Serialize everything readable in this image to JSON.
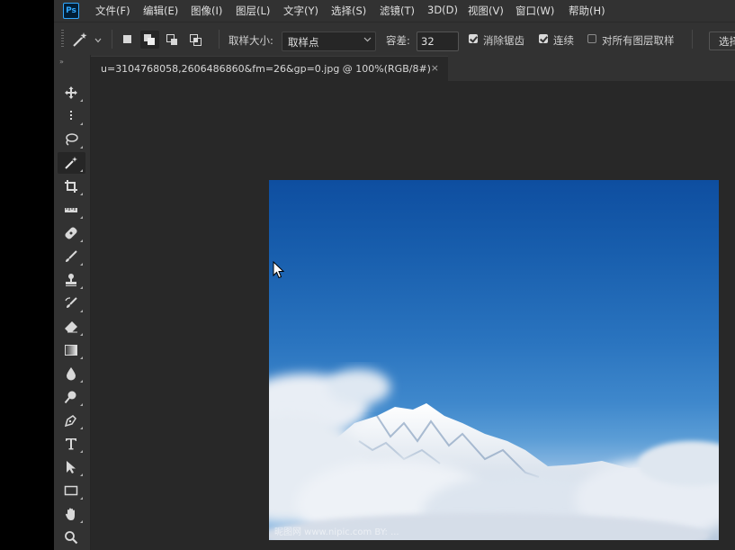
{
  "app": {
    "logo_text": "Ps",
    "menu": [
      "文件(F)",
      "编辑(E)",
      "图像(I)",
      "图层(L)",
      "文字(Y)",
      "选择(S)",
      "滤镜(T)",
      "3D(D)",
      "视图(V)",
      "窗口(W)",
      "帮助(H)"
    ]
  },
  "options": {
    "sample_size_label": "取样大小:",
    "sample_size_value": "取样点",
    "tolerance_label": "容差:",
    "tolerance_value": "32",
    "anti_alias_label": "消除锯齿",
    "anti_alias_checked": true,
    "contiguous_label": "连续",
    "contiguous_checked": true,
    "all_layers_label": "对所有图层取样",
    "all_layers_checked": false,
    "select_subject_label": "选择"
  },
  "document": {
    "tab_title": "u=3104768058,2606486860&fm=26&gp=0.jpg @ 100%(RGB/8#)",
    "close_glyph": "×",
    "watermark": "昵图网 www.nipic.com   BY: ..."
  },
  "toolbar": {
    "collapse_glyph": "»",
    "tools": [
      "move-tool",
      "marquee-tool",
      "lasso-tool",
      "magic-wand-tool",
      "crop-tool",
      "ruler-tool",
      "healing-brush-tool",
      "brush-tool",
      "clone-stamp-tool",
      "history-brush-tool",
      "eraser-tool",
      "gradient-tool",
      "blur-tool",
      "dodge-tool",
      "pen-tool",
      "type-tool",
      "path-selection-tool",
      "rectangle-tool",
      "hand-tool",
      "zoom-tool"
    ],
    "active_tool": "magic-wand-tool"
  },
  "colors": {
    "accent": "#31a8ff",
    "panel": "#323232",
    "canvas": "#282828",
    "sky_top": "#0e4ea0",
    "sky_bottom": "#8ab8e2"
  }
}
